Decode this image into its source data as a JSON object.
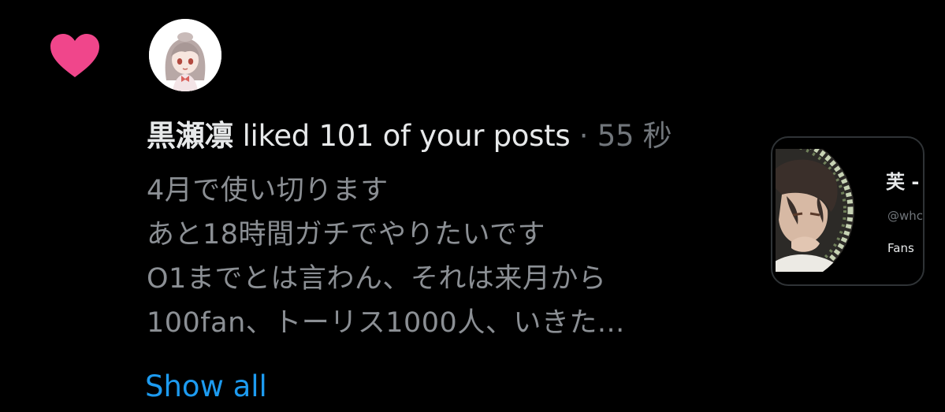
{
  "notification": {
    "type_icon": "heart-icon",
    "actor_avatar_icon": "user-avatar",
    "actor_name": "黒瀬凛",
    "action_text": " liked 101 of your posts",
    "separator": " · ",
    "timestamp": "55 秒",
    "post_lines": [
      "4月で使い切ります",
      "あと18時間ガチでやりたいです",
      "O1までとは言わん、それは来月から",
      "100fan、トーリス1000人、いきた..."
    ],
    "show_all_label": "Show all"
  },
  "profile_card": {
    "name": "芙 -",
    "handle": "@whc",
    "fans_label": "Fans"
  },
  "colors": {
    "background": "#000000",
    "heart": "#f0468b",
    "primary_text": "#e7e9ea",
    "secondary_text": "#71767b",
    "post_text": "#8b8f94",
    "link": "#1d9bf0",
    "card_border": "#2f3336"
  }
}
